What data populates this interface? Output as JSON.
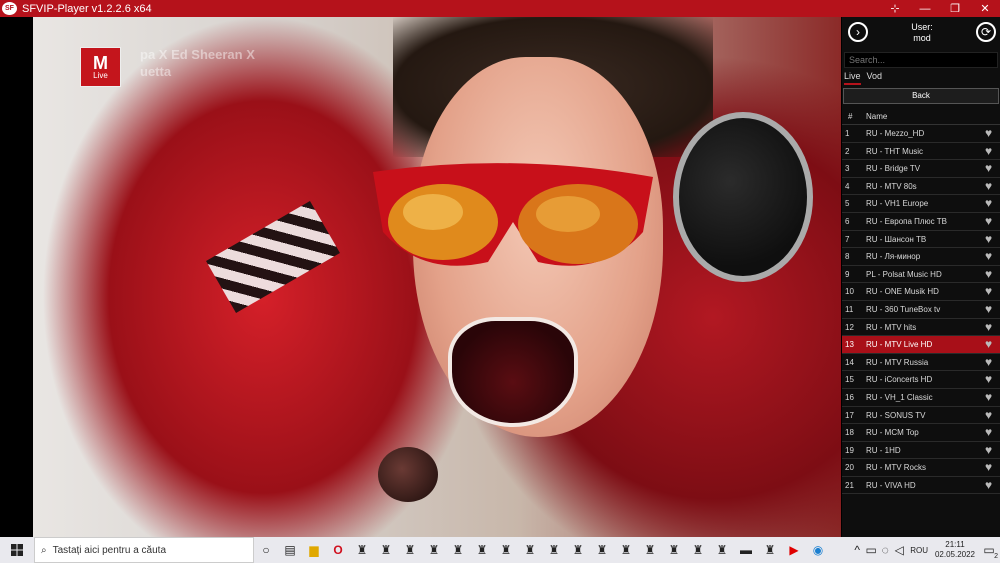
{
  "window": {
    "title": "SFVIP-Player v1.2.2.6 x64",
    "controls": {
      "pin": "⊹",
      "minimize": "—",
      "maximize": "❐",
      "close": "✕"
    },
    "brand_color": "#b5121b"
  },
  "video": {
    "logo_main": "M",
    "logo_sub": "Live",
    "overlay_line1": "pa X Ed Sheeran X",
    "overlay_line2": "uetta"
  },
  "sidebar": {
    "nav_icon": "chevron-right-icon",
    "refresh_icon": "refresh-icon",
    "user_label": "User:",
    "user_name": "mod",
    "search_placeholder": "Search...",
    "tabs": [
      "Live",
      "Vod"
    ],
    "active_tab": "Live",
    "back_label": "Back",
    "col_num": "#",
    "col_name": "Name",
    "selected_color": "#a80f18",
    "channels": [
      {
        "num": "1",
        "name": "RU - Mezzo_HD"
      },
      {
        "num": "2",
        "name": "RU - THT Music"
      },
      {
        "num": "3",
        "name": "RU - Bridge TV"
      },
      {
        "num": "4",
        "name": "RU - MTV 80s"
      },
      {
        "num": "5",
        "name": "RU - VH1 Europe"
      },
      {
        "num": "6",
        "name": "RU - Европа Плюс ТВ"
      },
      {
        "num": "7",
        "name": "RU - Шансон ТВ"
      },
      {
        "num": "8",
        "name": "RU - Ля-минор"
      },
      {
        "num": "9",
        "name": "PL - Polsat Music HD"
      },
      {
        "num": "10",
        "name": "RU - ONE Musik HD"
      },
      {
        "num": "11",
        "name": "RU - 360 TuneBox tv"
      },
      {
        "num": "12",
        "name": "RU - MTV hits"
      },
      {
        "num": "13",
        "name": "RU - MTV Live HD"
      },
      {
        "num": "14",
        "name": "RU - MTV Russia"
      },
      {
        "num": "15",
        "name": "RU - iConcerts HD"
      },
      {
        "num": "16",
        "name": "RU - VH_1 Classic"
      },
      {
        "num": "17",
        "name": "RU - SONUS TV"
      },
      {
        "num": "18",
        "name": "RU - MCM Top"
      },
      {
        "num": "19",
        "name": "RU - 1HD"
      },
      {
        "num": "20",
        "name": "RU - MTV Rocks"
      },
      {
        "num": "21",
        "name": "RU - VIVA HD"
      }
    ],
    "selected_index": 12
  },
  "taskbar": {
    "search_placeholder": "Tastați aici pentru a căuta",
    "language": "ROU",
    "time": "21:11",
    "date": "02.05.2022",
    "notification_count": "2"
  }
}
